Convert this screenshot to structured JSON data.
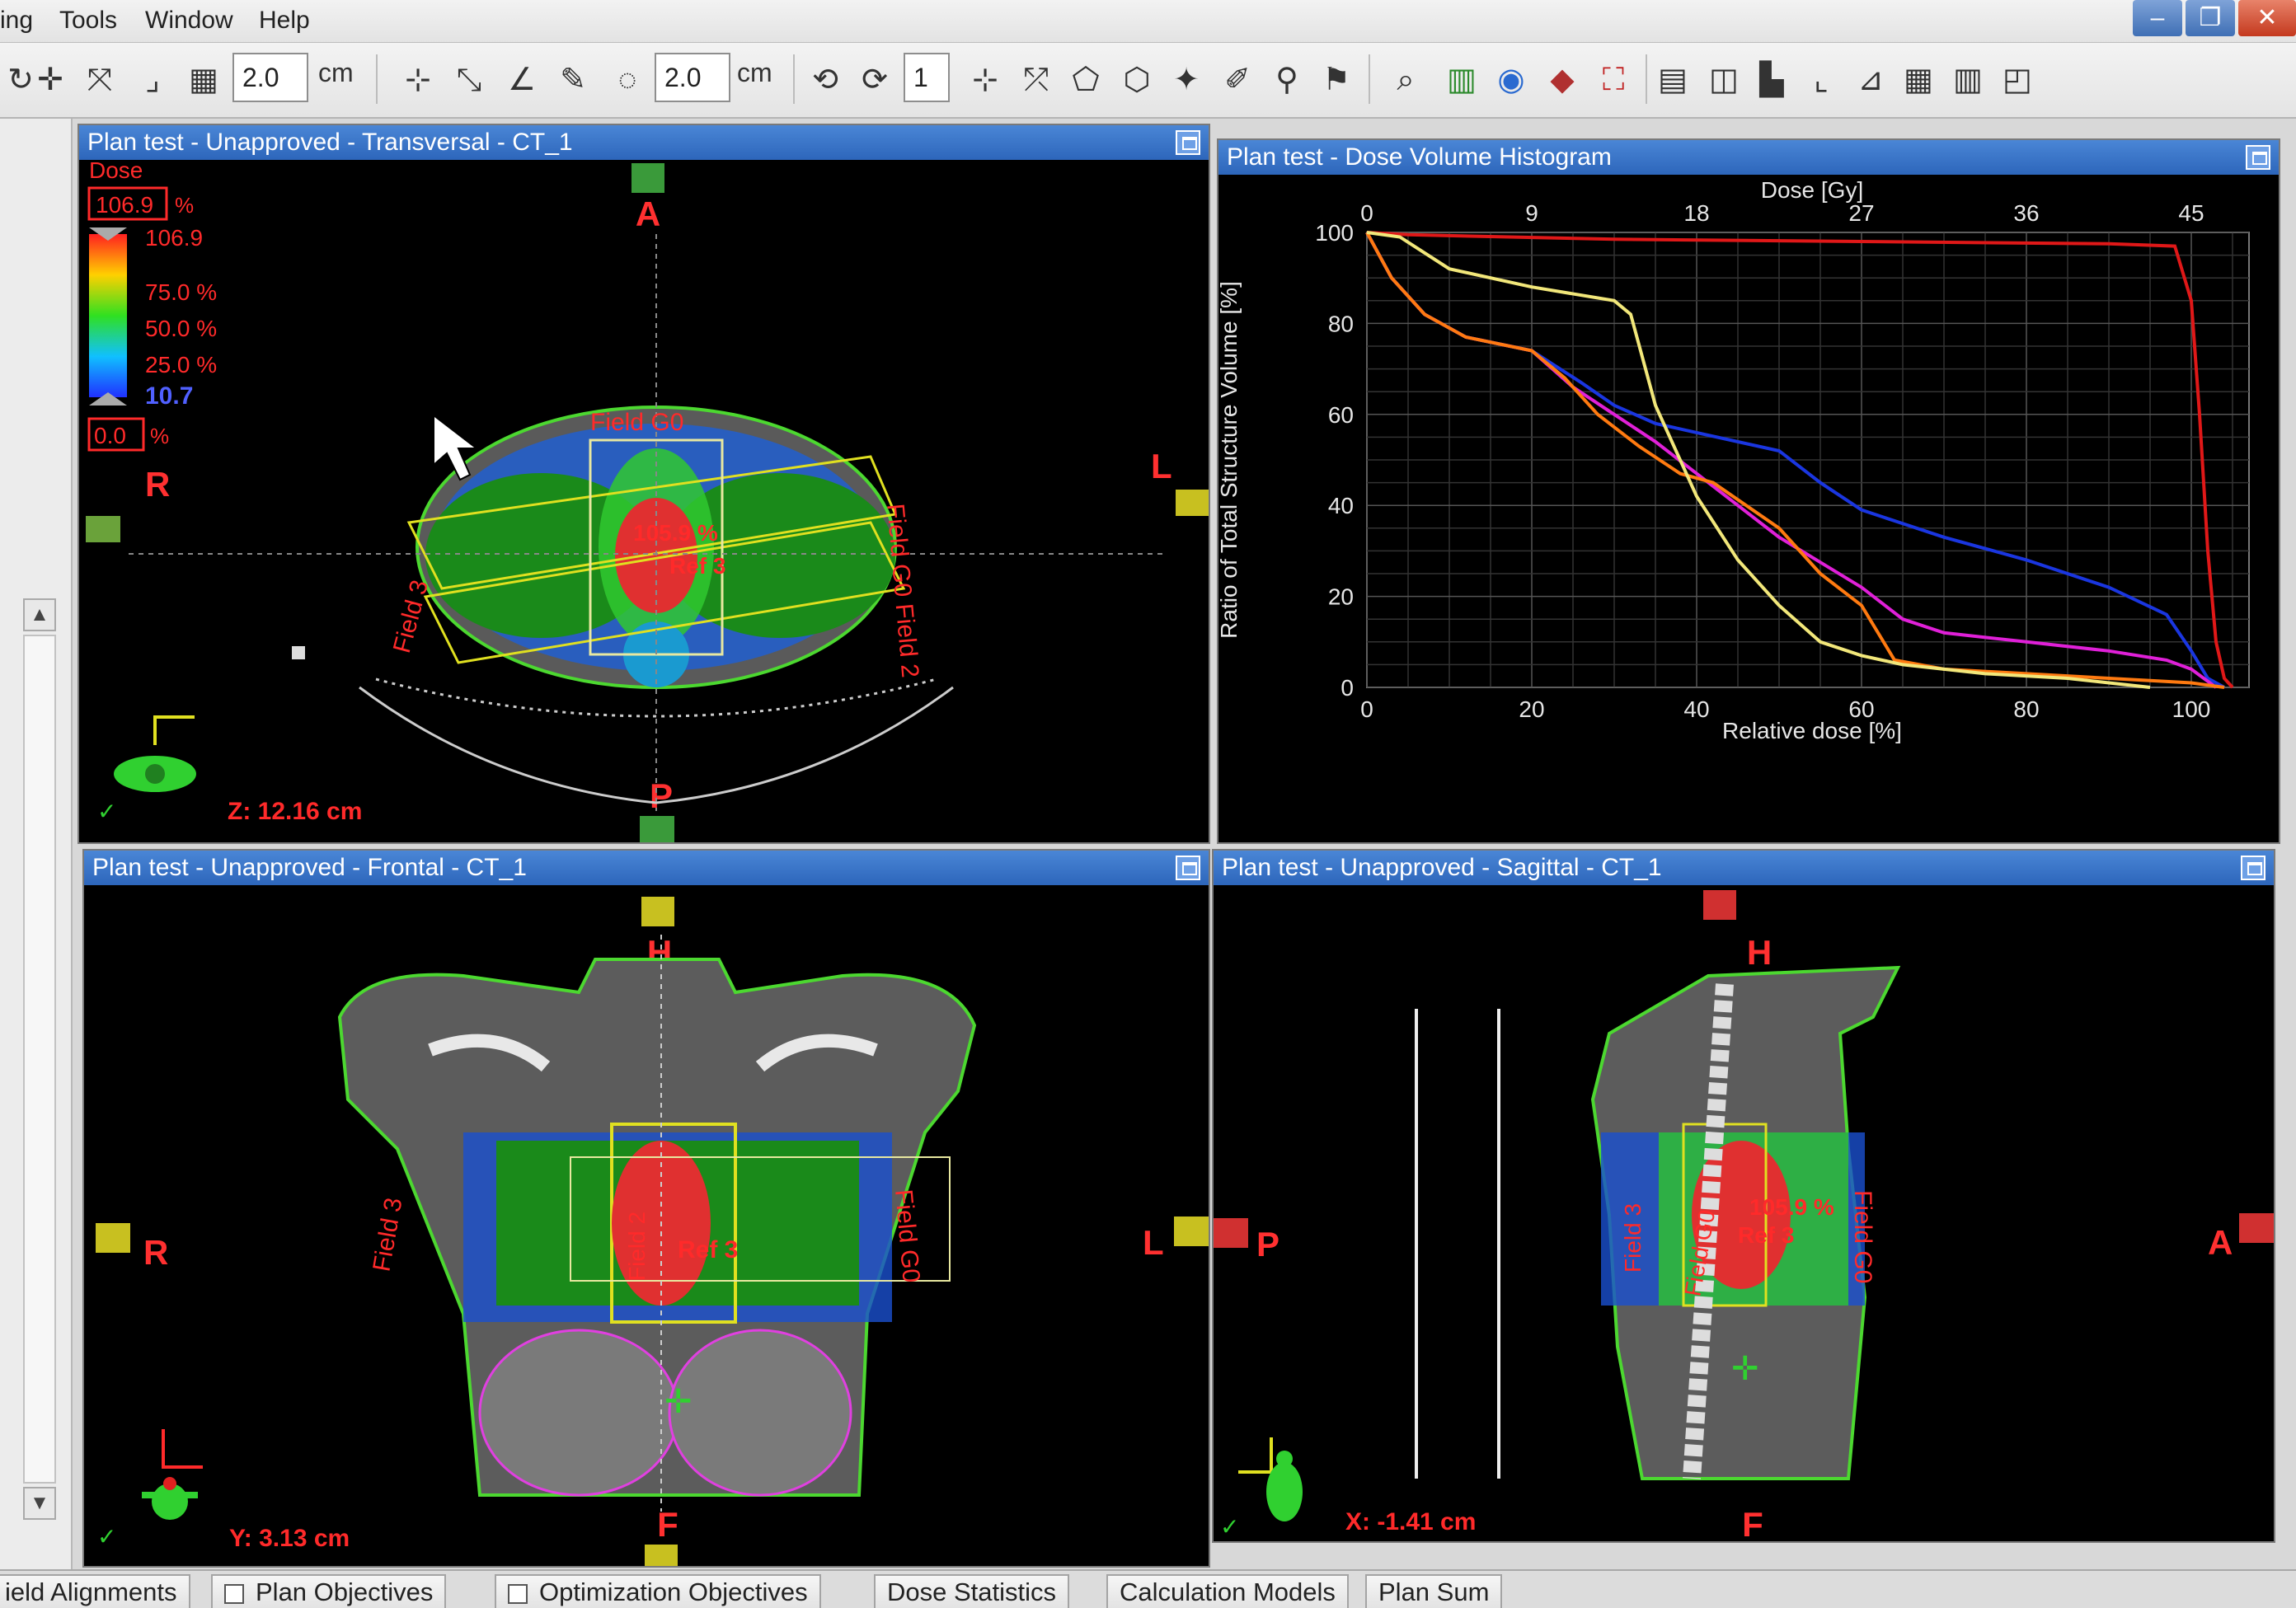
{
  "menu": {
    "items": [
      "ing",
      "Tools",
      "Window",
      "Help"
    ]
  },
  "window_controls": {
    "minimize": "–",
    "restore": "❐",
    "close": "✕"
  },
  "toolbar": {
    "field1_value": "2.0",
    "field1_unit": "cm",
    "field2_value": "2.0",
    "field2_unit": "cm",
    "field3_value": "1"
  },
  "panels": {
    "transversal": {
      "title": "Plan test  -  Unapproved - Transversal - CT_1",
      "dose_label": "Dose",
      "dose_max_box": "106.9",
      "dose_pct": "%",
      "dose_max": "106.9",
      "levels": [
        "75.0 %",
        "50.0 %",
        "25.0 %"
      ],
      "dose_min": "10.7",
      "dose_zero_box": "0.0",
      "orient": {
        "A": "A",
        "P": "P",
        "R": "R",
        "L": "L"
      },
      "field_labels": {
        "top": "Field G0",
        "left": "Field 3",
        "right": "Field G0 Field 2"
      },
      "dose_point": "105.9 %",
      "ref": "Ref 3",
      "coord": "Z: 12.16 cm"
    },
    "dvh": {
      "title": "Plan test - Dose Volume Histogram"
    },
    "frontal": {
      "title": "Plan test  -  Unapproved - Frontal - CT_1",
      "orient": {
        "H": "H",
        "F": "F",
        "R": "R",
        "L": "L"
      },
      "field_labels": {
        "left": "Field 3",
        "right": "Field G0",
        "center": "Field 2"
      },
      "ref": "Ref 3",
      "coord": "Y: 3.13 cm"
    },
    "sagittal": {
      "title": "Plan test  -  Unapproved - Sagittal - CT_1",
      "orient": {
        "H": "H",
        "F": "F",
        "P": "P",
        "A": "A"
      },
      "field_labels": {
        "left": "Field 3",
        "mid": "Field G0",
        "right": "Field G0"
      },
      "dose_point": "105.9 %",
      "ref": "Ref 3",
      "coord": "X: -1.41 cm"
    }
  },
  "chart_data": {
    "type": "line",
    "title": "",
    "xlabel": "Relative dose [%]",
    "x2label": "Dose [Gy]",
    "ylabel": "Ratio of Total Structure Volume [%]",
    "xlim": [
      0,
      107
    ],
    "ylim": [
      0,
      100
    ],
    "xticks": [
      0,
      20,
      40,
      60,
      80,
      100
    ],
    "x2ticks": [
      {
        "label": "0",
        "x": 0
      },
      {
        "label": "9",
        "x": 20
      },
      {
        "label": "18",
        "x": 40
      },
      {
        "label": "27",
        "x": 60
      },
      {
        "label": "36",
        "x": 80
      },
      {
        "label": "45",
        "x": 100
      }
    ],
    "yticks": [
      0,
      20,
      40,
      60,
      80,
      100
    ],
    "grid": true,
    "series": [
      {
        "color": "#e01818",
        "points": [
          [
            0,
            100
          ],
          [
            5,
            99.5
          ],
          [
            30,
            98.5
          ],
          [
            60,
            98
          ],
          [
            90,
            97.5
          ],
          [
            98,
            97
          ],
          [
            100,
            85
          ],
          [
            101,
            60
          ],
          [
            102,
            30
          ],
          [
            103,
            10
          ],
          [
            104,
            2
          ],
          [
            105,
            0
          ]
        ]
      },
      {
        "color": "#1a36e0",
        "points": [
          [
            0,
            100
          ],
          [
            3,
            90
          ],
          [
            7,
            82
          ],
          [
            12,
            77
          ],
          [
            20,
            74
          ],
          [
            26,
            67
          ],
          [
            30,
            62
          ],
          [
            35,
            58
          ],
          [
            40,
            56
          ],
          [
            50,
            52
          ],
          [
            55,
            45
          ],
          [
            60,
            39
          ],
          [
            70,
            33
          ],
          [
            80,
            28
          ],
          [
            90,
            22
          ],
          [
            97,
            16
          ],
          [
            100,
            8
          ],
          [
            102,
            2
          ],
          [
            104,
            0
          ]
        ]
      },
      {
        "color": "#e020d8",
        "points": [
          [
            0,
            100
          ],
          [
            3,
            90
          ],
          [
            7,
            82
          ],
          [
            12,
            77
          ],
          [
            20,
            74
          ],
          [
            25,
            66
          ],
          [
            30,
            60
          ],
          [
            35,
            54
          ],
          [
            40,
            47
          ],
          [
            45,
            40
          ],
          [
            50,
            33
          ],
          [
            60,
            22
          ],
          [
            65,
            15
          ],
          [
            70,
            12
          ],
          [
            80,
            10
          ],
          [
            90,
            8
          ],
          [
            97,
            6
          ],
          [
            100,
            4
          ],
          [
            103,
            0
          ]
        ]
      },
      {
        "color": "#ff7a10",
        "points": [
          [
            0,
            100
          ],
          [
            3,
            90
          ],
          [
            7,
            82
          ],
          [
            12,
            77
          ],
          [
            20,
            74
          ],
          [
            24,
            68
          ],
          [
            28,
            60
          ],
          [
            33,
            53
          ],
          [
            38,
            47
          ],
          [
            42,
            45
          ],
          [
            50,
            35
          ],
          [
            55,
            25
          ],
          [
            60,
            18
          ],
          [
            64,
            6
          ],
          [
            70,
            4
          ],
          [
            80,
            3
          ],
          [
            90,
            2
          ],
          [
            100,
            1
          ],
          [
            104,
            0
          ]
        ]
      },
      {
        "color": "#f2e77a",
        "points": [
          [
            0,
            100
          ],
          [
            4,
            99
          ],
          [
            10,
            92
          ],
          [
            20,
            88
          ],
          [
            30,
            85
          ],
          [
            32,
            82
          ],
          [
            35,
            62
          ],
          [
            40,
            42
          ],
          [
            45,
            28
          ],
          [
            50,
            18
          ],
          [
            55,
            10
          ],
          [
            60,
            7
          ],
          [
            65,
            5
          ],
          [
            75,
            3
          ],
          [
            85,
            2
          ],
          [
            95,
            0
          ]
        ]
      }
    ]
  },
  "tabs": [
    {
      "label": "ield Alignments",
      "check": false
    },
    {
      "label": "Plan Objectives",
      "check": true
    },
    {
      "label": "Optimization Objectives",
      "check": true
    },
    {
      "label": "Dose Statistics",
      "check": false
    },
    {
      "label": "Calculation Models",
      "check": false
    },
    {
      "label": "Plan Sum",
      "check": false
    }
  ]
}
